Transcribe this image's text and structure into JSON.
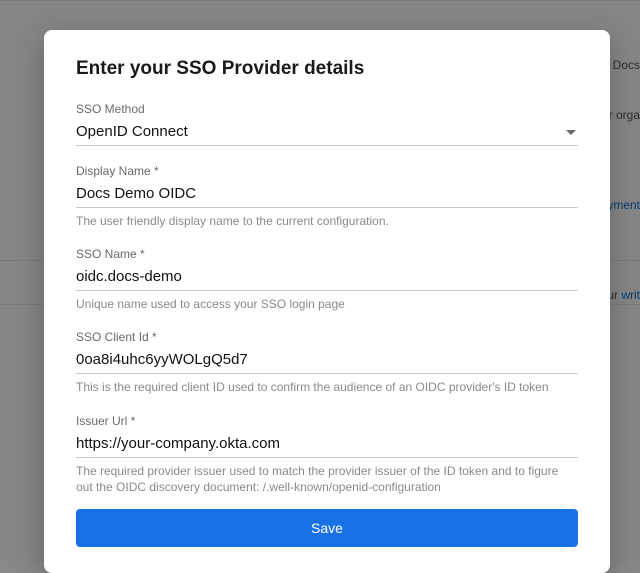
{
  "backdrop": {
    "line1": "e Docs",
    "line2": "our orga",
    "link_payment": "Payment",
    "line3_pre": "our ",
    "line3_link": "writ"
  },
  "modal": {
    "title": "Enter your SSO Provider details",
    "save_label": "Save"
  },
  "fields": {
    "sso_method": {
      "label": "SSO Method",
      "value": "OpenID Connect"
    },
    "display_name": {
      "label": "Display Name *",
      "value": "Docs Demo OIDC",
      "help": "The user friendly display name to the current configuration."
    },
    "sso_name": {
      "label": "SSO Name *",
      "value": "oidc.docs-demo",
      "help": "Unique name used to access your SSO login page"
    },
    "client_id": {
      "label": "SSO Client Id *",
      "value": "0oa8i4uhc6yyWOLgQ5d7",
      "help": "This is the required client ID used to confirm the audience of an OIDC provider's ID token"
    },
    "issuer_url": {
      "label": "Issuer Url *",
      "value": "https://your-company.okta.com",
      "help": "The required provider issuer used to match the provider issuer of the ID token and to figure out the OIDC discovery document: /.well-known/openid-configuration"
    }
  }
}
